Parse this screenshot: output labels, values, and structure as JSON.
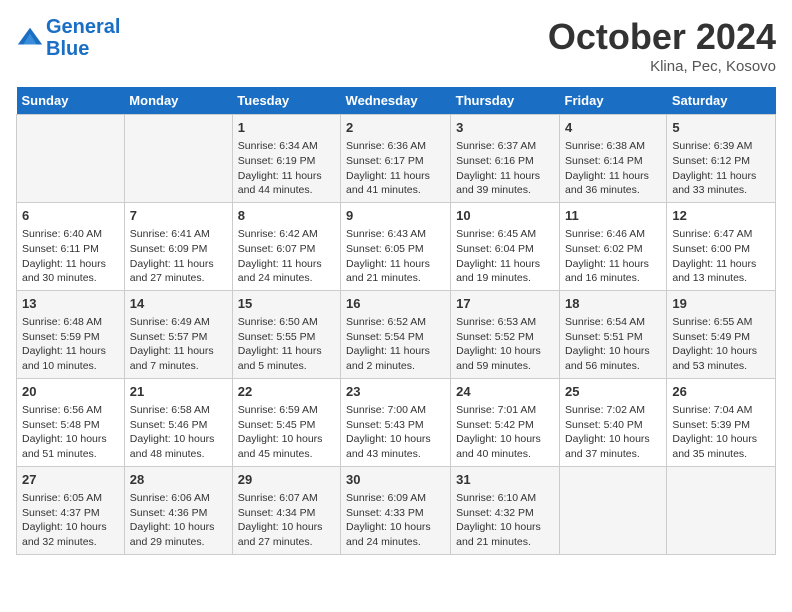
{
  "header": {
    "logo_line1": "General",
    "logo_line2": "Blue",
    "month": "October 2024",
    "location": "Klina, Pec, Kosovo"
  },
  "days_of_week": [
    "Sunday",
    "Monday",
    "Tuesday",
    "Wednesday",
    "Thursday",
    "Friday",
    "Saturday"
  ],
  "weeks": [
    [
      {
        "day": "",
        "content": ""
      },
      {
        "day": "",
        "content": ""
      },
      {
        "day": "1",
        "content": "Sunrise: 6:34 AM\nSunset: 6:19 PM\nDaylight: 11 hours and 44 minutes."
      },
      {
        "day": "2",
        "content": "Sunrise: 6:36 AM\nSunset: 6:17 PM\nDaylight: 11 hours and 41 minutes."
      },
      {
        "day": "3",
        "content": "Sunrise: 6:37 AM\nSunset: 6:16 PM\nDaylight: 11 hours and 39 minutes."
      },
      {
        "day": "4",
        "content": "Sunrise: 6:38 AM\nSunset: 6:14 PM\nDaylight: 11 hours and 36 minutes."
      },
      {
        "day": "5",
        "content": "Sunrise: 6:39 AM\nSunset: 6:12 PM\nDaylight: 11 hours and 33 minutes."
      }
    ],
    [
      {
        "day": "6",
        "content": "Sunrise: 6:40 AM\nSunset: 6:11 PM\nDaylight: 11 hours and 30 minutes."
      },
      {
        "day": "7",
        "content": "Sunrise: 6:41 AM\nSunset: 6:09 PM\nDaylight: 11 hours and 27 minutes."
      },
      {
        "day": "8",
        "content": "Sunrise: 6:42 AM\nSunset: 6:07 PM\nDaylight: 11 hours and 24 minutes."
      },
      {
        "day": "9",
        "content": "Sunrise: 6:43 AM\nSunset: 6:05 PM\nDaylight: 11 hours and 21 minutes."
      },
      {
        "day": "10",
        "content": "Sunrise: 6:45 AM\nSunset: 6:04 PM\nDaylight: 11 hours and 19 minutes."
      },
      {
        "day": "11",
        "content": "Sunrise: 6:46 AM\nSunset: 6:02 PM\nDaylight: 11 hours and 16 minutes."
      },
      {
        "day": "12",
        "content": "Sunrise: 6:47 AM\nSunset: 6:00 PM\nDaylight: 11 hours and 13 minutes."
      }
    ],
    [
      {
        "day": "13",
        "content": "Sunrise: 6:48 AM\nSunset: 5:59 PM\nDaylight: 11 hours and 10 minutes."
      },
      {
        "day": "14",
        "content": "Sunrise: 6:49 AM\nSunset: 5:57 PM\nDaylight: 11 hours and 7 minutes."
      },
      {
        "day": "15",
        "content": "Sunrise: 6:50 AM\nSunset: 5:55 PM\nDaylight: 11 hours and 5 minutes."
      },
      {
        "day": "16",
        "content": "Sunrise: 6:52 AM\nSunset: 5:54 PM\nDaylight: 11 hours and 2 minutes."
      },
      {
        "day": "17",
        "content": "Sunrise: 6:53 AM\nSunset: 5:52 PM\nDaylight: 10 hours and 59 minutes."
      },
      {
        "day": "18",
        "content": "Sunrise: 6:54 AM\nSunset: 5:51 PM\nDaylight: 10 hours and 56 minutes."
      },
      {
        "day": "19",
        "content": "Sunrise: 6:55 AM\nSunset: 5:49 PM\nDaylight: 10 hours and 53 minutes."
      }
    ],
    [
      {
        "day": "20",
        "content": "Sunrise: 6:56 AM\nSunset: 5:48 PM\nDaylight: 10 hours and 51 minutes."
      },
      {
        "day": "21",
        "content": "Sunrise: 6:58 AM\nSunset: 5:46 PM\nDaylight: 10 hours and 48 minutes."
      },
      {
        "day": "22",
        "content": "Sunrise: 6:59 AM\nSunset: 5:45 PM\nDaylight: 10 hours and 45 minutes."
      },
      {
        "day": "23",
        "content": "Sunrise: 7:00 AM\nSunset: 5:43 PM\nDaylight: 10 hours and 43 minutes."
      },
      {
        "day": "24",
        "content": "Sunrise: 7:01 AM\nSunset: 5:42 PM\nDaylight: 10 hours and 40 minutes."
      },
      {
        "day": "25",
        "content": "Sunrise: 7:02 AM\nSunset: 5:40 PM\nDaylight: 10 hours and 37 minutes."
      },
      {
        "day": "26",
        "content": "Sunrise: 7:04 AM\nSunset: 5:39 PM\nDaylight: 10 hours and 35 minutes."
      }
    ],
    [
      {
        "day": "27",
        "content": "Sunrise: 6:05 AM\nSunset: 4:37 PM\nDaylight: 10 hours and 32 minutes."
      },
      {
        "day": "28",
        "content": "Sunrise: 6:06 AM\nSunset: 4:36 PM\nDaylight: 10 hours and 29 minutes."
      },
      {
        "day": "29",
        "content": "Sunrise: 6:07 AM\nSunset: 4:34 PM\nDaylight: 10 hours and 27 minutes."
      },
      {
        "day": "30",
        "content": "Sunrise: 6:09 AM\nSunset: 4:33 PM\nDaylight: 10 hours and 24 minutes."
      },
      {
        "day": "31",
        "content": "Sunrise: 6:10 AM\nSunset: 4:32 PM\nDaylight: 10 hours and 21 minutes."
      },
      {
        "day": "",
        "content": ""
      },
      {
        "day": "",
        "content": ""
      }
    ]
  ]
}
